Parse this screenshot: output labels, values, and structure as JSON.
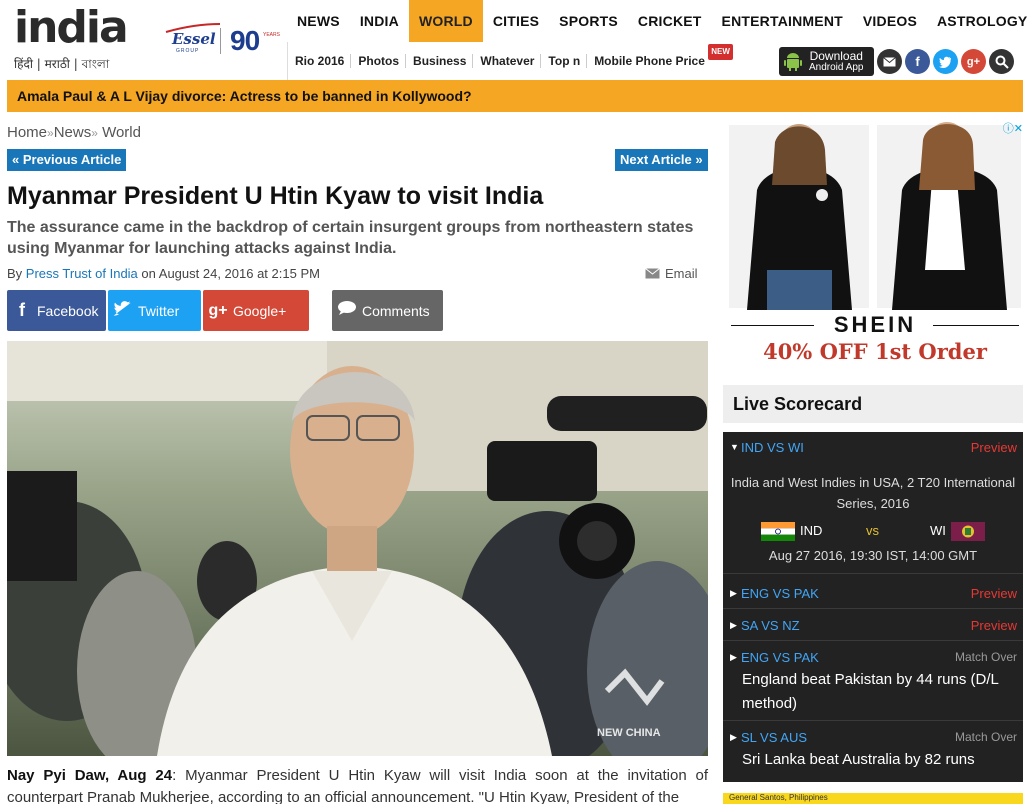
{
  "header": {
    "logo_text_main": "india",
    "logo_languages": "हिंदी | मराठी | বাংলা",
    "essel_logo_text": "Essel",
    "essel_sub": "GROUP",
    "essel_ninety": "90",
    "essel_years": "YEARS"
  },
  "nav": {
    "items": [
      "NEWS",
      "INDIA",
      "WORLD",
      "CITIES",
      "SPORTS",
      "CRICKET",
      "ENTERTAINMENT",
      "VIDEOS",
      "ASTROLOGY"
    ],
    "active": "WORLD"
  },
  "subnav": {
    "items": [
      "Rio 2016",
      "Photos",
      "Business",
      "Whatever",
      "Top n",
      "Mobile Phone Price"
    ],
    "new_badge": "NEW"
  },
  "app": {
    "line1": "Download",
    "line2": "Android App"
  },
  "social_top": {
    "email_icon": "envelope-icon",
    "facebook_icon": "f",
    "twitter_icon": "bird-icon",
    "google_icon": "g+",
    "search_icon": "magnifier-icon"
  },
  "ticker": "Amala Paul & A L Vijay divorce: Actress to be banned in Kollywood?",
  "breadcrumb": {
    "home": "Home",
    "news": "News",
    "world": "World",
    "sep": "»"
  },
  "article_nav": {
    "prev": "« Previous Article",
    "next": "Next Article »"
  },
  "article": {
    "headline": "Myanmar President U Htin Kyaw to visit India",
    "summary": "The assurance came in the backdrop of certain insurgent groups from northeastern states using Myanmar for launching attacks against India.",
    "by_prefix": "By",
    "author": "Press Trust of India",
    "date_text": "on August 24, 2016 at 2:15 PM",
    "email_label": "Email",
    "dateline": "Nay Pyi Daw, Aug 24",
    "body": ":  Myanmar President U Htin Kyaw will visit India soon at the invitation of counterpart Pranab Mukherjee, according to an official announcement. \"U Htin Kyaw, President of the",
    "photo_watermark": "NEW CHINA"
  },
  "share": {
    "facebook": "Facebook",
    "twitter": "Twitter",
    "google": "Google+",
    "comments": "Comments"
  },
  "ad": {
    "brand": "SHEIN",
    "offer": "40% OFF 1st Order",
    "choice_icon": "adchoices-icon"
  },
  "scorecard": {
    "title": "Live Scorecard",
    "matches": [
      {
        "title": "IND VS WI",
        "status": "Preview",
        "series": "India and West Indies in USA, 2 T20 International Series, 2016",
        "team1": "IND",
        "vs": "vs",
        "team2": "WI",
        "datetime": "Aug 27 2016, 19:30 IST, 14:00 GMT"
      },
      {
        "title": "ENG VS PAK",
        "status": "Preview"
      },
      {
        "title": "SA VS NZ",
        "status": "Preview"
      },
      {
        "title": "ENG VS PAK",
        "status": "Match Over",
        "result": "England beat Pakistan by 44 runs (D/L method)"
      },
      {
        "title": "SL VS AUS",
        "status": "Match Over",
        "result": "Sri Lanka beat Australia by 82 runs"
      }
    ]
  },
  "bottom_ad": "General Santos, Philippines",
  "colors": {
    "accent_orange": "#f5a623",
    "link_blue": "#1976b8",
    "facebook": "#3b5998",
    "twitter": "#1da1f2",
    "google": "#d34836",
    "scorecard_bg": "#222222",
    "preview_red": "#e53935"
  }
}
